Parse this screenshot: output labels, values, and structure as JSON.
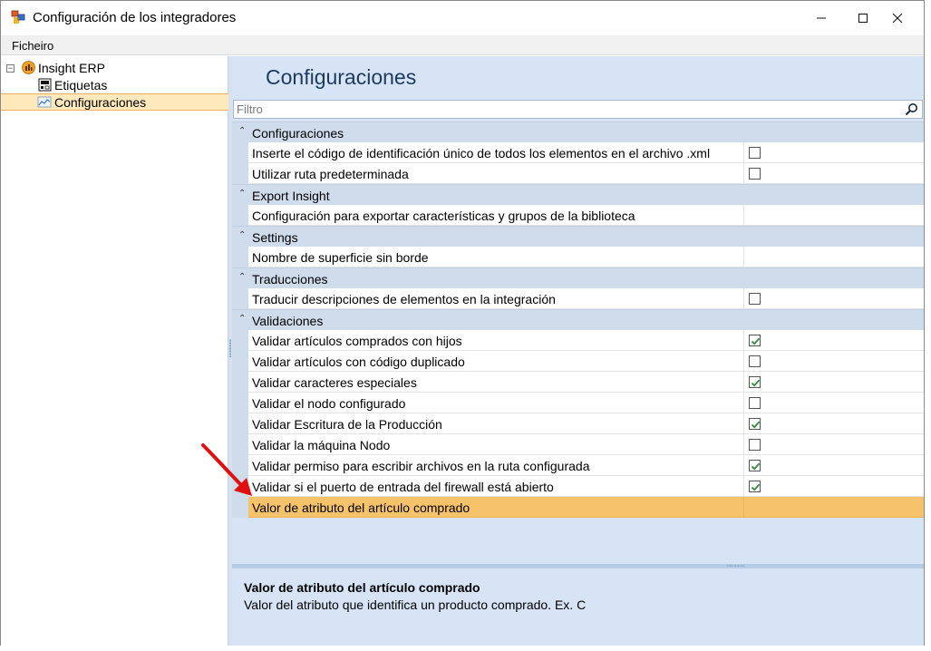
{
  "window": {
    "title": "Configuración de los integradores",
    "minimize": "—",
    "maximize": "☐",
    "close": "✕"
  },
  "menu": {
    "items": [
      "Ficheiro"
    ]
  },
  "tree": {
    "root": "Insight ERP",
    "children": [
      {
        "label": "Etiquetas"
      },
      {
        "label": "Configuraciones"
      }
    ],
    "expander": "−"
  },
  "main": {
    "title": "Configuraciones",
    "filter_placeholder": "Filtro"
  },
  "grid": {
    "categories": [
      {
        "label": "Configuraciones",
        "toggle": "⌃",
        "rows": [
          {
            "label": "Inserte el código de identificación único de todos los elementos en el archivo .xml",
            "checkbox": true,
            "checked": false
          },
          {
            "label": "Utilizar ruta predeterminada",
            "checkbox": true,
            "checked": false
          }
        ]
      },
      {
        "label": "Export Insight",
        "toggle": "⌃",
        "rows": [
          {
            "label": "Configuración para exportar características y grupos de la biblioteca",
            "checkbox": false
          }
        ]
      },
      {
        "label": "Settings",
        "toggle": "⌃",
        "rows": [
          {
            "label": "Nombre de superficie sin borde",
            "checkbox": false
          }
        ]
      },
      {
        "label": "Traducciones",
        "toggle": "⌃",
        "rows": [
          {
            "label": "Traducir descripciones de elementos en la integración",
            "checkbox": true,
            "checked": false
          }
        ]
      },
      {
        "label": "Validaciones",
        "toggle": "⌃",
        "rows": [
          {
            "label": "Validar artículos comprados con hijos",
            "checkbox": true,
            "checked": true
          },
          {
            "label": "Validar artículos con código duplicado",
            "checkbox": true,
            "checked": false
          },
          {
            "label": "Validar caracteres especiales",
            "checkbox": true,
            "checked": true
          },
          {
            "label": "Validar el nodo configurado",
            "checkbox": true,
            "checked": false
          },
          {
            "label": "Validar Escritura de la Producción",
            "checkbox": true,
            "checked": true
          },
          {
            "label": "Validar la máquina Nodo",
            "checkbox": true,
            "checked": false
          },
          {
            "label": "Validar permiso para escribir archivos en la ruta configurada",
            "checkbox": true,
            "checked": true
          },
          {
            "label": "Validar si el puerto de entrada del firewall está abierto",
            "checkbox": true,
            "checked": true
          },
          {
            "label": "Valor de atributo del artículo comprado",
            "checkbox": false,
            "selected": true
          }
        ]
      }
    ]
  },
  "description": {
    "title": "Valor de atributo del artículo comprado",
    "text": "Valor del atributo que identifica un producto comprado. Ex. C"
  },
  "colors": {
    "selection": "#f6c36b",
    "panel": "#d6e4f5",
    "arrow": "#e01010",
    "check": "#2e8b3a"
  }
}
